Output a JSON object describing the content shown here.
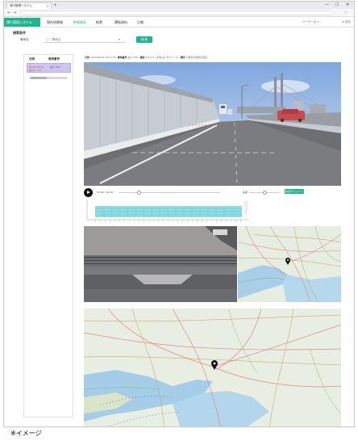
{
  "browser": {
    "tab_title": "運行管理システム",
    "new_tab": "+",
    "tab_close": "×",
    "window_controls": [
      "—",
      "☐",
      "✕"
    ],
    "back": "←",
    "forward": "→",
    "bookmark": "☆"
  },
  "app": {
    "title": "運行管理システム",
    "nav": [
      {
        "label": "現在地情報",
        "active": false
      },
      {
        "label": "映像確認",
        "active": true
      },
      {
        "label": "帳票",
        "active": false
      },
      {
        "label": "運転傾向",
        "active": false
      },
      {
        "label": "日報",
        "active": false
      }
    ],
    "user_menu": "ユーザー名 ▾",
    "settings": "⚙ 設定",
    "accent": "#1fb58f"
  },
  "search": {
    "section_title": "検索条件",
    "label": "車両名",
    "placeholder": "□ □車両名",
    "caret": "▾",
    "button": "検 索"
  },
  "list": {
    "headers": [
      "日時",
      "車両番号"
    ],
    "rows": [
      {
        "time": "04/22 10:51",
        "vehicle": "品川 500",
        "sub": "急ブレーキ"
      }
    ]
  },
  "info": {
    "date_label": "日時",
    "date": "2023/04/22 10:51:05",
    "vehicle_label": "車両番号",
    "vehicle": "品川 500",
    "speed_label": "速度",
    "speed": "54km/h",
    "event_label": "イベント",
    "event": "急ブレーキ",
    "location_label": "場所",
    "location": "大阪府大阪市此花区"
  },
  "player": {
    "time": "00:06 / 00:30",
    "speed_label": "速度",
    "export_button": "動画ダウンロード"
  },
  "caption": "※イメージ"
}
